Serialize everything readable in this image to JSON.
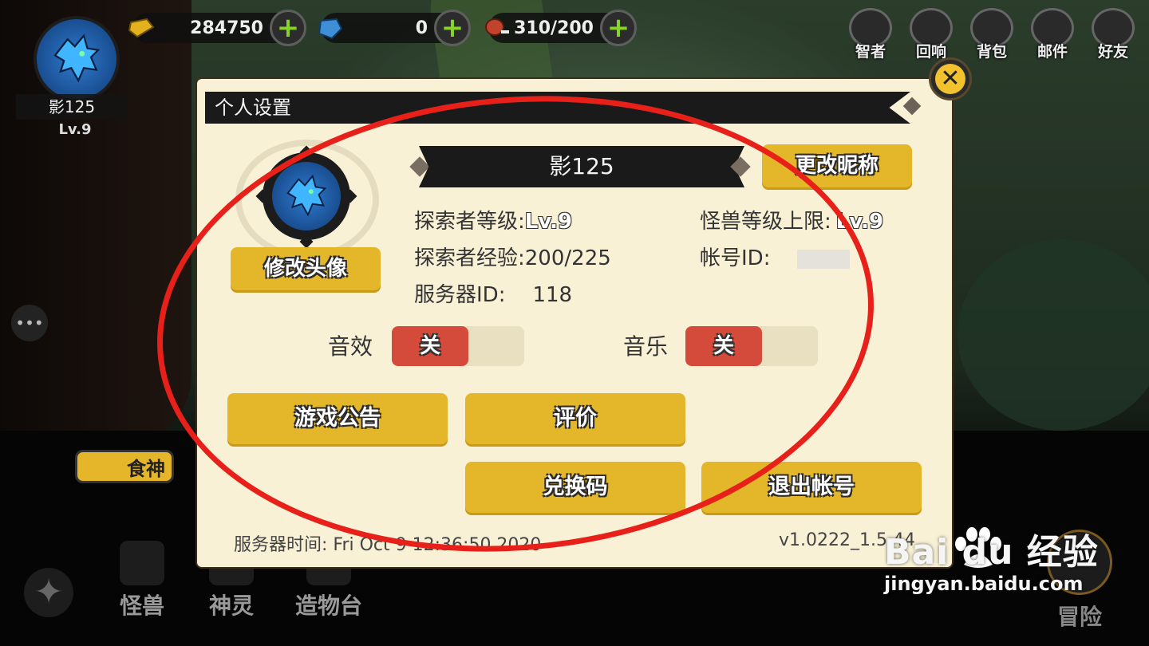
{
  "hud": {
    "player_name": "影125",
    "player_level": "Lv.9",
    "gold": "284750",
    "gems": "0",
    "stamina": "310/200",
    "top_icons": [
      {
        "label": "智者",
        "icon": "sage-icon"
      },
      {
        "label": "回响",
        "icon": "echo-icon"
      },
      {
        "label": "背包",
        "icon": "backpack-icon"
      },
      {
        "label": "邮件",
        "icon": "mail-icon"
      },
      {
        "label": "好友",
        "icon": "friends-icon"
      }
    ],
    "food_label": "食神",
    "bottom_nav": [
      "怪兽",
      "神灵",
      "造物台"
    ],
    "adventure_label": "冒险"
  },
  "dialog": {
    "title": "个人设置",
    "nickname": "影125",
    "change_nickname_button": "更改昵称",
    "change_avatar_button": "修改头像",
    "explorer_level_label": "探索者等级:",
    "explorer_level_value": "Lv.9",
    "monster_level_cap_label": "怪兽等级上限:",
    "monster_level_cap_value": "Lv.9",
    "explorer_exp_label": "探索者经验:",
    "explorer_exp_value": "200/225",
    "account_id_label": "帐号ID:",
    "server_id_label": "服务器ID:",
    "server_id_value": "118",
    "sound_label": "音效",
    "sound_state": "关",
    "music_label": "音乐",
    "music_state": "关",
    "buttons": {
      "announcement": "游戏公告",
      "rate": "评价",
      "redeem": "兑换码",
      "logout": "退出帐号"
    },
    "server_time": "服务器时间: Fri Oct  9 12:36:50 2020",
    "version": "v1.0222_1.5.44"
  },
  "watermark": {
    "brand": "Bai du 经验",
    "url": "jingyan.baidu.com"
  },
  "colors": {
    "button_yellow": "#e4b72a",
    "toggle_off_red": "#d44a3b",
    "panel_cream": "#f9f1d6",
    "annotation_red": "#e8201a"
  }
}
